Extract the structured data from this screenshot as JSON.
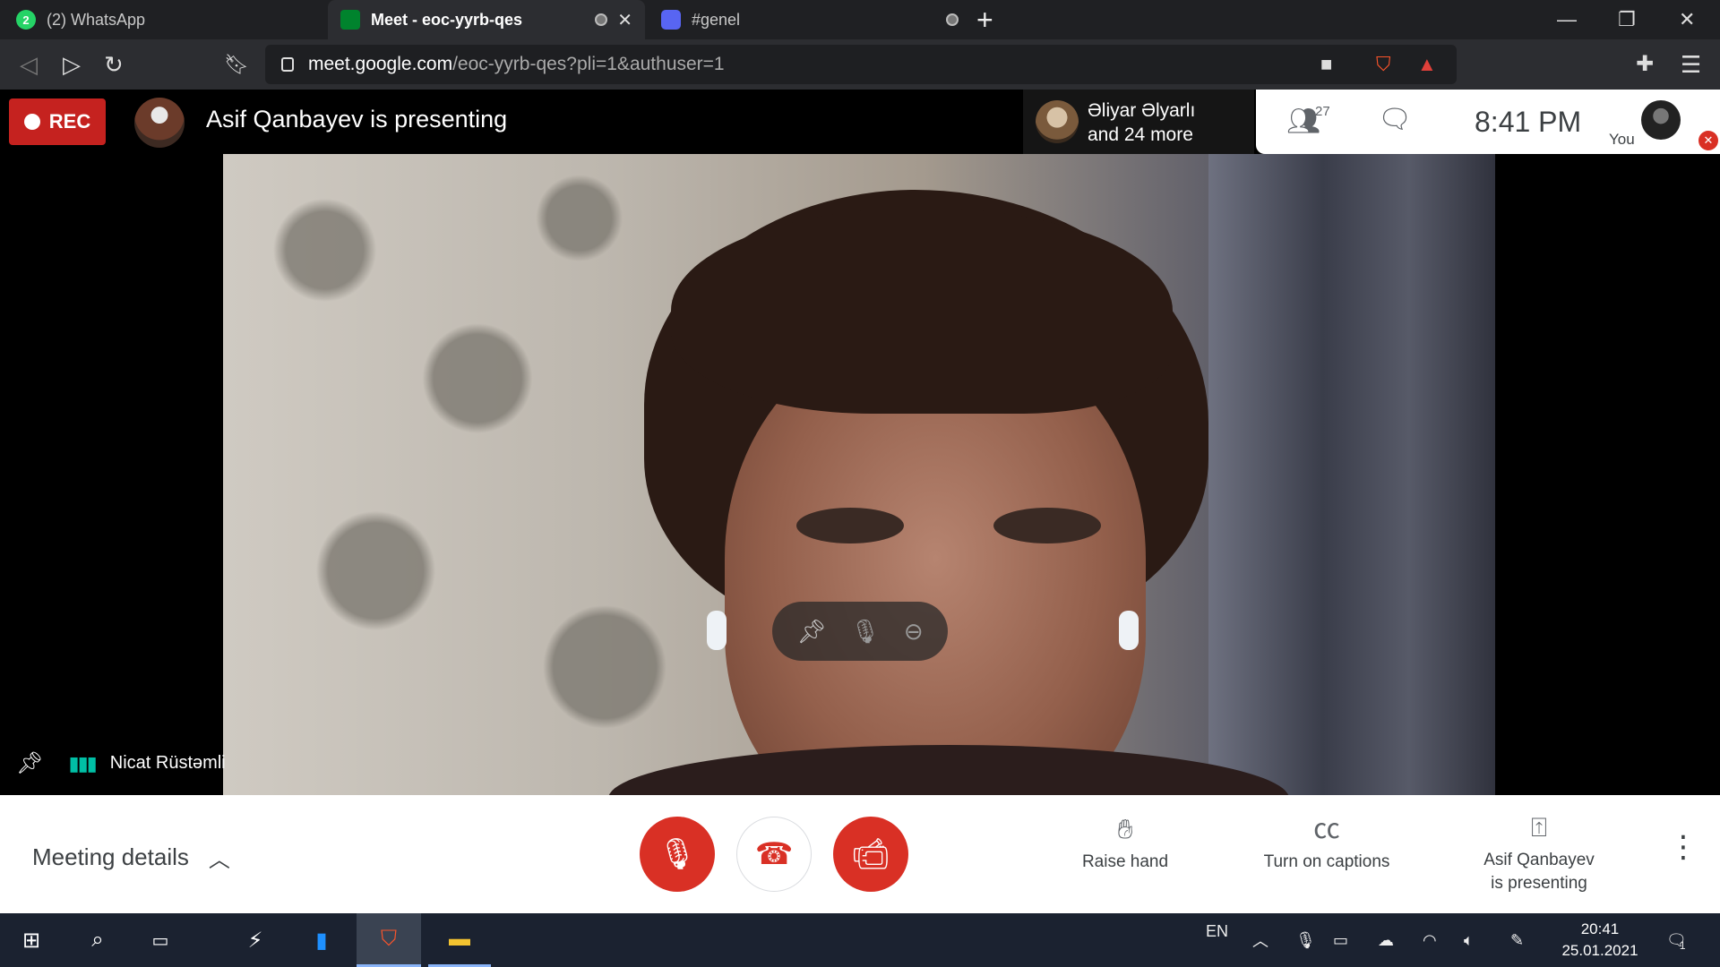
{
  "browser": {
    "tabs": [
      {
        "title": "(2) WhatsApp",
        "badge": "2",
        "favicon_color": "#25d366",
        "active": false
      },
      {
        "title": "Meet - eoc-yyrb-qes",
        "favicon_color": "#00832d",
        "active": true
      },
      {
        "title": "#genel",
        "favicon_color": "#5865f2",
        "active": false
      }
    ],
    "url_host": "meet.google.com",
    "url_path": "/eoc-yyrb-qes?pli=1&authuser=1"
  },
  "meet": {
    "rec_label": "REC",
    "presenting_text": "Asif Qanbayev is presenting",
    "others_line1": "Əliyar Əlyarlı",
    "others_line2": "and 24 more",
    "participant_count": "27",
    "time": "8:41  PM",
    "self_label": "You",
    "speaker_name": "Nicat Rüstəmli",
    "meeting_details_label": "Meeting details",
    "raise_hand_label": "Raise hand",
    "captions_label": "Turn on captions",
    "presenting_line1": "Asif Qanbayev",
    "presenting_line2": "is presenting"
  },
  "taskbar": {
    "language": "EN",
    "clock_time": "20:41",
    "clock_date": "25.01.2021",
    "notification_count": "1"
  },
  "colors": {
    "meet_red": "#d93025",
    "rec_red": "#c5221f",
    "speaking_teal": "#00bfa5"
  }
}
